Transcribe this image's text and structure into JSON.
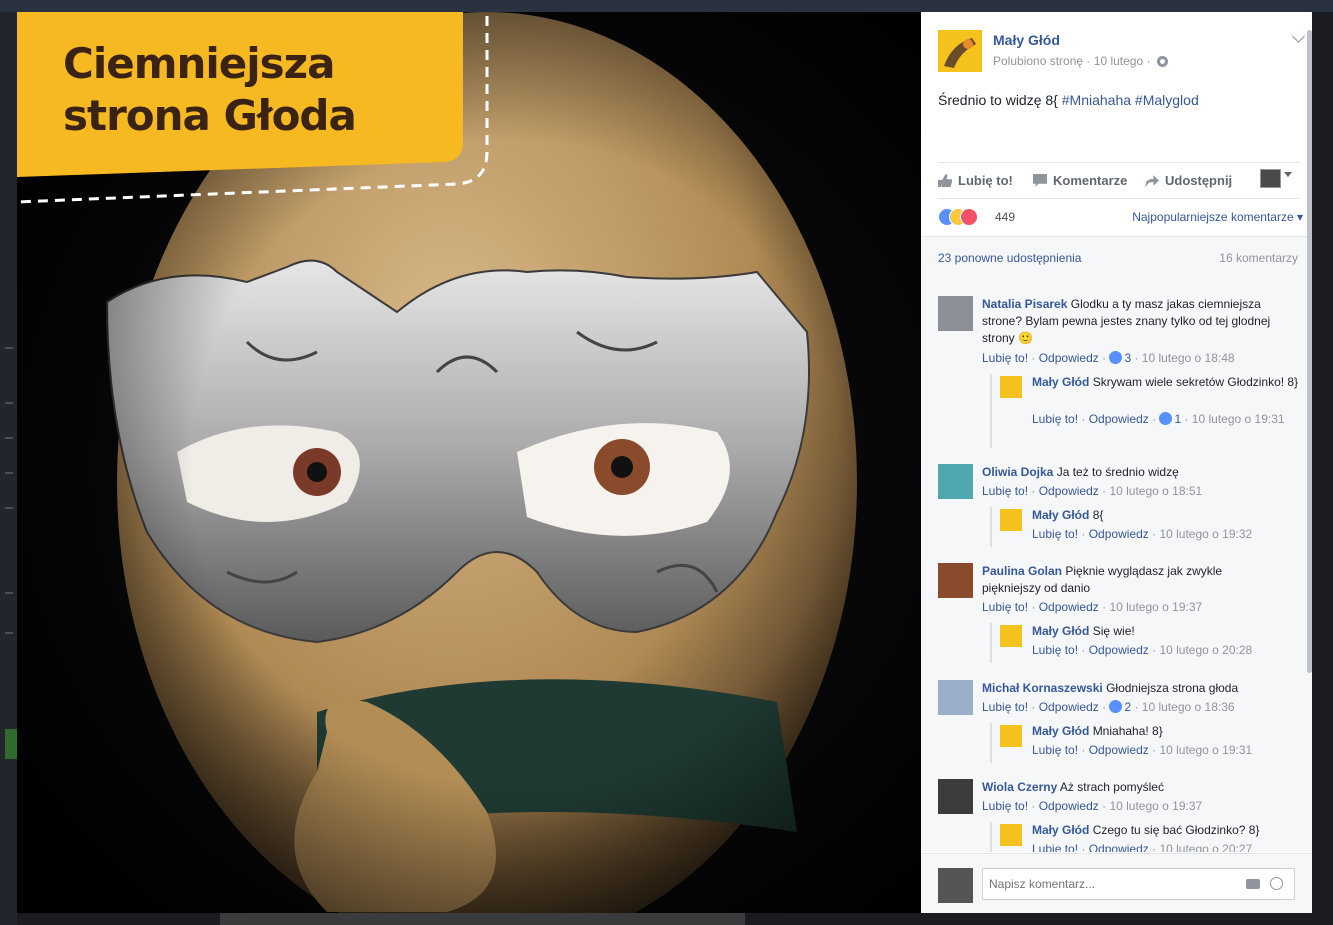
{
  "photo": {
    "banner_title_line1": "Ciemniejsza",
    "banner_title_line2": "strona Głoda"
  },
  "post": {
    "page_name": "Mały Głód",
    "liked_label": "Polubiono stronę",
    "date": "10 lutego",
    "separator": "·",
    "text_plain": "Średnio to widzę 8{ ",
    "hashtag1": "#Mniahaha",
    "hashtag2": "#Malyglod"
  },
  "actions": {
    "like": "Lubię to!",
    "comment": "Komentarze",
    "share": "Udostępnij"
  },
  "reactions": {
    "count": "449",
    "sort_label": "Najpopularniejsze komentarze ▾"
  },
  "stats": {
    "shares": "23 ponowne udostępnienia",
    "comments": "16 komentarzy"
  },
  "comments": [
    {
      "author": "Natalia Pisarek",
      "text": "Glodku a ty masz jakas ciemniejsza strone? Bylam pewna jestes znany tylko od tej glodnej strony 🙂",
      "like": "Lubię to!",
      "reply": "Odpowiedz",
      "likes": "3",
      "time": "10 lutego o 18:48",
      "reply_item": {
        "author": "Mały Głód",
        "text": "Skrywam wiele sekretów Głodzinko! 8}",
        "like": "Lubię to!",
        "reply": "Odpowiedz",
        "likes": "1",
        "time": "10 lutego o 19:31"
      }
    },
    {
      "author": "Oliwia Dojka",
      "text": "Ja też to średnio widzę",
      "like": "Lubię to!",
      "reply": "Odpowiedz",
      "time": "10 lutego o 18:51",
      "reply_item": {
        "author": "Mały Głód",
        "text": "8{",
        "like": "Lubię to!",
        "reply": "Odpowiedz",
        "time": "10 lutego o 19:32"
      }
    },
    {
      "author": "Paulina Golan",
      "text": "Pięknie wyglądasz jak zwykle piękniejszy od danio",
      "like": "Lubię to!",
      "reply": "Odpowiedz",
      "time": "10 lutego o 19:37",
      "reply_item": {
        "author": "Mały Głód",
        "text": "Się wie!",
        "like": "Lubię to!",
        "reply": "Odpowiedz",
        "time": "10 lutego o 20:28"
      }
    },
    {
      "author": "Michał Kornaszewski",
      "text": "Głodniejsza strona głoda",
      "like": "Lubię to!",
      "reply": "Odpowiedz",
      "likes": "2",
      "time": "10 lutego o 18:36",
      "reply_item": {
        "author": "Mały Głód",
        "text": "Mniahaha! 8}",
        "like": "Lubię to!",
        "reply": "Odpowiedz",
        "time": "10 lutego o 19:31"
      }
    },
    {
      "author": "Wiola Czerny",
      "text": "Aż strach pomyśleć",
      "like": "Lubię to!",
      "reply": "Odpowiedz",
      "time": "10 lutego o 19:37",
      "reply_item": {
        "author": "Mały Głód",
        "text": "Czego tu się bać Głodzinko? 8}",
        "like": "Lubię to!",
        "reply": "Odpowiedz",
        "time": "10 lutego o 20:27"
      }
    }
  ],
  "composer": {
    "placeholder": "Napisz komentarz..."
  },
  "colors": {
    "link": "#365899",
    "banner_yellow": "#f6b921",
    "banner_text": "#3b2314"
  }
}
